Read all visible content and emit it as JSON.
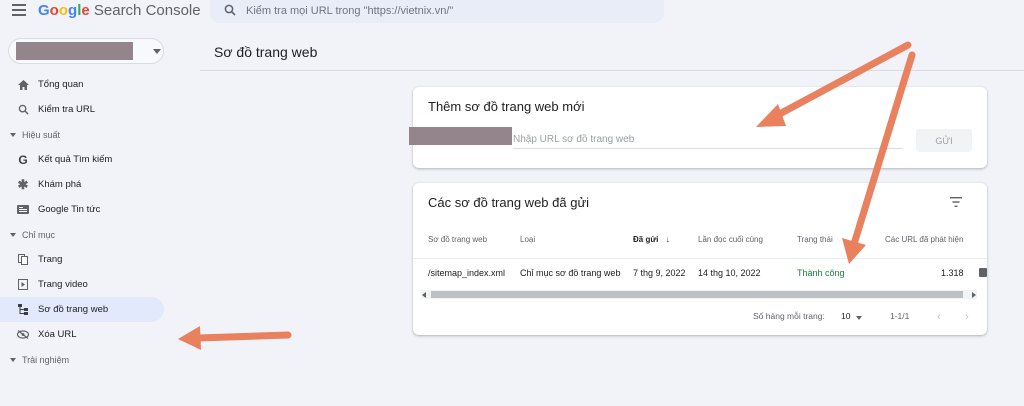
{
  "app": {
    "brand_google": "Google",
    "brand_product": "Search Console"
  },
  "search": {
    "placeholder": "Kiểm tra mọi URL trong \"https://vietnix.vn/\""
  },
  "sidebar": {
    "items": [
      {
        "label": "Tổng quan",
        "icon": "home-icon"
      },
      {
        "label": "Kiểm tra URL",
        "icon": "search-icon"
      }
    ],
    "sections": [
      {
        "label": "Hiệu suất",
        "items": [
          {
            "label": "Kết quả Tìm kiếm",
            "icon": "google-g-icon"
          },
          {
            "label": "Khám phá",
            "icon": "asterisk-icon"
          },
          {
            "label": "Google Tin tức",
            "icon": "news-icon"
          }
        ]
      },
      {
        "label": "Chỉ mục",
        "items": [
          {
            "label": "Trang",
            "icon": "pages-icon"
          },
          {
            "label": "Trang video",
            "icon": "video-page-icon"
          },
          {
            "label": "Sơ đồ trang web",
            "icon": "sitemap-icon",
            "active": true
          },
          {
            "label": "Xóa URL",
            "icon": "eye-off-icon"
          }
        ]
      },
      {
        "label": "Trải nghiệm",
        "items": []
      }
    ]
  },
  "page": {
    "title": "Sơ đồ trang web"
  },
  "add_sitemap": {
    "title": "Thêm sơ đồ trang web mới",
    "input_placeholder": "Nhập URL sơ đồ trang web",
    "submit_label": "GỬI"
  },
  "submitted": {
    "title": "Các sơ đồ trang web đã gửi",
    "columns": [
      "Sơ đồ trang web",
      "Loại",
      "Đã gửi",
      "Lần đọc cuối cùng",
      "Trạng thái",
      "Các URL đã phát hiện"
    ],
    "sort_arrow": "↓",
    "rows": [
      {
        "sitemap": "/sitemap_index.xml",
        "type": "Chỉ mục sơ đồ trang web",
        "submitted": "7 thg 9, 2022",
        "last_read": "14 thg 10, 2022",
        "status": "Thành công",
        "discovered": "1.318"
      }
    ],
    "pager": {
      "rows_per_page_label": "Số hàng mỗi trang:",
      "rows_per_page": "10",
      "range": "1-1/1",
      "prev": "‹",
      "next": "›"
    }
  },
  "colors": {
    "annotation_arrow": "#e9805e",
    "active_nav": "#e1e9fb",
    "success": "#188038"
  }
}
